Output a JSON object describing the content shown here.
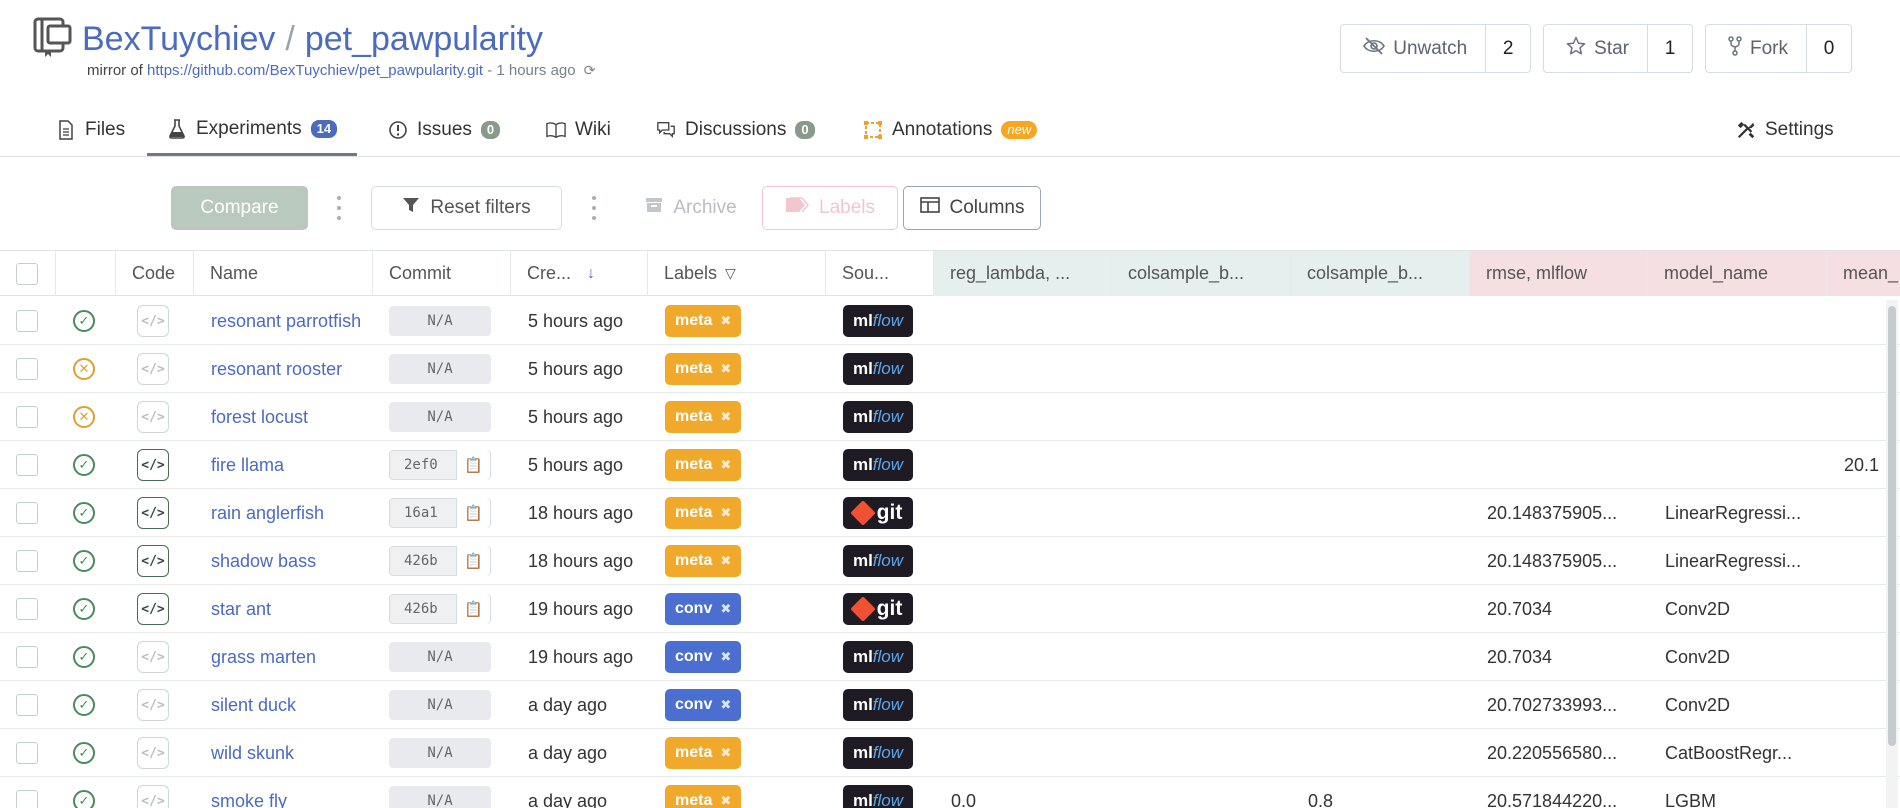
{
  "repo": {
    "owner": "BexTuychiev",
    "separator": "/",
    "name": "pet_pawpularity",
    "mirror_prefix": "mirror of",
    "mirror_url": "https://github.com/BexTuychiev/pet_pawpularity.git",
    "mirror_age": "- 1 hours ago"
  },
  "repo_buttons": [
    {
      "label": "Unwatch",
      "count": "2",
      "icon": "eye-slash-icon"
    },
    {
      "label": "Star",
      "count": "1",
      "icon": "star-icon"
    },
    {
      "label": "Fork",
      "count": "0",
      "icon": "fork-icon"
    }
  ],
  "tabs": [
    {
      "label": "Files",
      "icon": "file-icon"
    },
    {
      "label": "Experiments",
      "badge": "14",
      "icon": "flask-icon",
      "active": true
    },
    {
      "label": "Issues",
      "badge": "0",
      "icon": "issue-icon"
    },
    {
      "label": "Wiki",
      "icon": "book-icon"
    },
    {
      "label": "Discussions",
      "badge": "0",
      "icon": "chat-icon"
    },
    {
      "label": "Annotations",
      "badge": "new",
      "icon": "annotation-icon"
    },
    {
      "label": "Settings",
      "icon": "tools-icon"
    }
  ],
  "toolbar": {
    "compare": "Compare",
    "reset_filters": "Reset filters",
    "archive": "Archive",
    "labels": "Labels",
    "columns": "Columns"
  },
  "columns": [
    "Code",
    "Name",
    "Commit",
    "Cre...",
    "Labels",
    "Sou...",
    "reg_lambda, ...",
    "colsample_b...",
    "colsample_b...",
    "rmse, mlflow",
    "model_name",
    "mean_"
  ],
  "label_colors": {
    "meta": "#f0a92a",
    "conv": "#4a6fd0"
  },
  "rows": [
    {
      "status": "success",
      "code": false,
      "name": "resonant parrotfish",
      "commit": "N/A",
      "created": "5 hours ago",
      "label": "meta",
      "source": "mlflow",
      "reg_lambda": "",
      "colsample_a": "",
      "colsample_b": "",
      "rmse": "",
      "model_name": "",
      "mean": ""
    },
    {
      "status": "failed",
      "code": false,
      "name": "resonant rooster",
      "commit": "N/A",
      "created": "5 hours ago",
      "label": "meta",
      "source": "mlflow",
      "reg_lambda": "",
      "colsample_a": "",
      "colsample_b": "",
      "rmse": "",
      "model_name": "",
      "mean": ""
    },
    {
      "status": "failed",
      "code": false,
      "name": "forest locust",
      "commit": "N/A",
      "created": "5 hours ago",
      "label": "meta",
      "source": "mlflow",
      "reg_lambda": "",
      "colsample_a": "",
      "colsample_b": "",
      "rmse": "",
      "model_name": "",
      "mean": ""
    },
    {
      "status": "success",
      "code": true,
      "name": "fire llama",
      "commit": "2ef0",
      "created": "5 hours ago",
      "label": "meta",
      "source": "mlflow",
      "reg_lambda": "",
      "colsample_a": "",
      "colsample_b": "",
      "rmse": "",
      "model_name": "",
      "mean": "20.1"
    },
    {
      "status": "success",
      "code": true,
      "name": "rain anglerfish",
      "commit": "16a1",
      "created": "18 hours ago",
      "label": "meta",
      "source": "git",
      "reg_lambda": "",
      "colsample_a": "",
      "colsample_b": "",
      "rmse": "20.148375905...",
      "model_name": "LinearRegressi...",
      "mean": ""
    },
    {
      "status": "success",
      "code": true,
      "name": "shadow bass",
      "commit": "426b",
      "created": "18 hours ago",
      "label": "meta",
      "source": "mlflow",
      "reg_lambda": "",
      "colsample_a": "",
      "colsample_b": "",
      "rmse": "20.148375905...",
      "model_name": "LinearRegressi...",
      "mean": ""
    },
    {
      "status": "success",
      "code": true,
      "name": "star ant",
      "commit": "426b",
      "created": "19 hours ago",
      "label": "conv",
      "source": "git",
      "reg_lambda": "",
      "colsample_a": "",
      "colsample_b": "",
      "rmse": "20.7034",
      "model_name": "Conv2D",
      "mean": ""
    },
    {
      "status": "success",
      "code": false,
      "name": "grass marten",
      "commit": "N/A",
      "created": "19 hours ago",
      "label": "conv",
      "source": "mlflow",
      "reg_lambda": "",
      "colsample_a": "",
      "colsample_b": "",
      "rmse": "20.7034",
      "model_name": "Conv2D",
      "mean": ""
    },
    {
      "status": "success",
      "code": false,
      "name": "silent duck",
      "commit": "N/A",
      "created": "a day ago",
      "label": "conv",
      "source": "mlflow",
      "reg_lambda": "",
      "colsample_a": "",
      "colsample_b": "",
      "rmse": "20.702733993...",
      "model_name": "Conv2D",
      "mean": ""
    },
    {
      "status": "success",
      "code": false,
      "name": "wild skunk",
      "commit": "N/A",
      "created": "a day ago",
      "label": "meta",
      "source": "mlflow",
      "reg_lambda": "",
      "colsample_a": "",
      "colsample_b": "",
      "rmse": "20.220556580...",
      "model_name": "CatBoostRegr...",
      "mean": ""
    },
    {
      "status": "success",
      "code": false,
      "name": "smoke fly",
      "commit": "N/A",
      "created": "a day ago",
      "label": "meta",
      "source": "mlflow",
      "reg_lambda": "0.0",
      "colsample_a": "",
      "colsample_b": "0.8",
      "rmse": "20.571844220...",
      "model_name": "LGBM",
      "mean": ""
    }
  ]
}
